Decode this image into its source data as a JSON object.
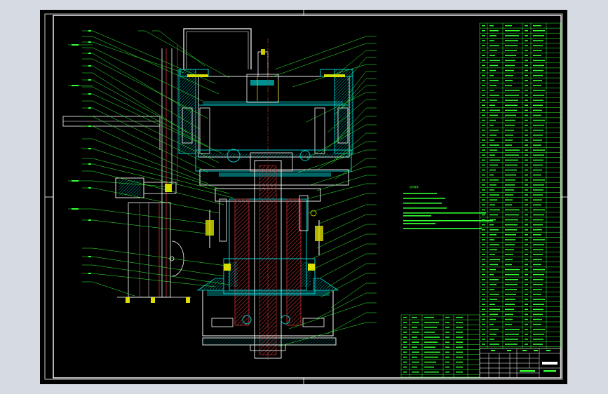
{
  "drawing": {
    "background": "#000000",
    "page_background": "#d5dae3",
    "colors": {
      "frame": "#ffffff",
      "leader": "#33ff33",
      "part": "#00cccc",
      "section": "#cc3333",
      "hidden": "#cccc00",
      "fastener": "#dddd00",
      "table": "#33ff33"
    },
    "legible_text": [
      "技术要求"
    ]
  }
}
